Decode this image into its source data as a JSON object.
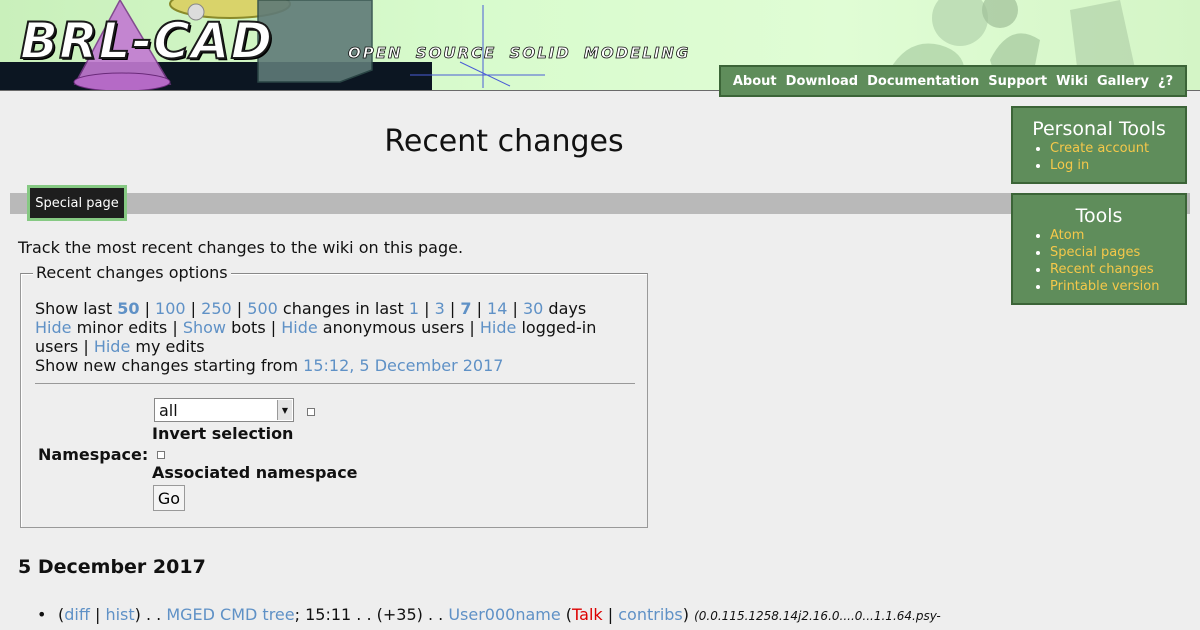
{
  "header": {
    "logo_text": "BRL-CAD",
    "tagline": "OPEN SOURCE SOLID MODELING",
    "nav": [
      "About",
      "Download",
      "Documentation",
      "Support",
      "Wiki",
      "Gallery",
      "¿?"
    ]
  },
  "page": {
    "title": "Recent changes",
    "tab_label": "Special page",
    "intro": "Track the most recent changes to the wiki on this page."
  },
  "options": {
    "legend": "Recent changes options",
    "show_last_prefix": "Show last",
    "limits": [
      "50",
      "100",
      "250",
      "500"
    ],
    "limits_selected": "50",
    "changes_in_last": "changes in last",
    "days_options": [
      "1",
      "3",
      "7",
      "14",
      "30"
    ],
    "days_selected": "7",
    "days_suffix": "days",
    "toggles_line1": {
      "hide_minor_link": "Hide",
      "minor_text": "minor edits |",
      "show_bots_link": "Show",
      "bots_text": "bots |",
      "hide_anon_link": "Hide",
      "anon_text": "anonymous users |",
      "hide_loggedin_link": "Hide",
      "loggedin_text": "logged-in"
    },
    "toggles_line2": {
      "users_text": "users |",
      "hide_my_link": "Hide",
      "my_text": "my edits"
    },
    "new_changes_prefix": "Show new changes starting from",
    "new_changes_link": "15:12, 5 December 2017",
    "namespace_label": "Namespace:",
    "namespace_selected": "all",
    "invert_label": "Invert selection",
    "associated_label": "Associated namespace",
    "go_label": "Go"
  },
  "changes": {
    "date_heading": "5 December 2017",
    "items": [
      {
        "diff": "diff",
        "hist": "hist",
        "page": "MGED CMD tree",
        "time": "15:11",
        "size": "(+35)",
        "user": "User000name",
        "talk": "Talk",
        "contribs": "contribs",
        "summary": "(0.0.115.1258.14j2.16.0....0...1.1.64.psy-"
      }
    ]
  },
  "sidebar": {
    "personal_title": "Personal Tools",
    "personal_items": [
      "Create account",
      "Log in"
    ],
    "tools_title": "Tools",
    "tools_items": [
      "Atom",
      "Special pages",
      "Recent changes",
      "Printable version"
    ]
  },
  "colors": {
    "link": "#5f91c6",
    "sidebar_bg": "#5f8d5b",
    "sidebar_link": "#f5c84a",
    "new_link": "#dd0000"
  }
}
